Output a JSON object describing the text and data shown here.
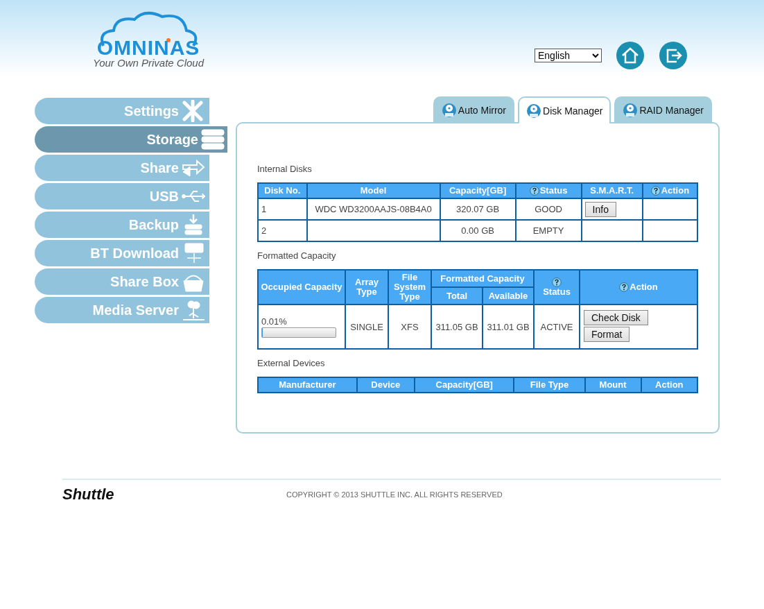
{
  "header": {
    "logo": {
      "brand": "OMNINAS",
      "tagline": "Your Own Private Cloud"
    },
    "language": "English"
  },
  "sidebar": {
    "items": [
      {
        "label": "Settings",
        "selected": false
      },
      {
        "label": "Storage",
        "selected": true
      },
      {
        "label": "Share",
        "selected": false
      },
      {
        "label": "USB",
        "selected": false
      },
      {
        "label": "Backup",
        "selected": false
      },
      {
        "label": "BT Download",
        "selected": false
      },
      {
        "label": "Share Box",
        "selected": false
      },
      {
        "label": "Media Server",
        "selected": false
      }
    ]
  },
  "tabs": [
    {
      "label": "Auto Mirror",
      "selected": false
    },
    {
      "label": "Disk Manager",
      "selected": true
    },
    {
      "label": "RAID Manager",
      "selected": false
    }
  ],
  "internal_disks": {
    "title": "Internal Disks",
    "columns": [
      {
        "label": "Disk No.",
        "help": false
      },
      {
        "label": "Model",
        "help": false
      },
      {
        "label": "Capacity[GB]",
        "help": false
      },
      {
        "label": "Status",
        "help": true
      },
      {
        "label": "S.M.A.R.T.",
        "help": false
      },
      {
        "label": "Action",
        "help": true
      }
    ],
    "rows": [
      {
        "disk_no": "1",
        "model": "WDC WD3200AAJS-08B4A0",
        "capacity": "320.07 GB",
        "status": "GOOD",
        "smart_button": "Info"
      },
      {
        "disk_no": "2",
        "capacity": "0.00 GB",
        "status": "EMPTY"
      }
    ]
  },
  "formatted_capacity": {
    "title": "Formatted Capacity",
    "headers": {
      "occupied": {
        "label": "Occupied Capacity",
        "help": false
      },
      "array_type": {
        "label": "Array Type",
        "help": false
      },
      "file_system": {
        "label": "File System Type",
        "help": false
      },
      "formatted": {
        "label": "Formatted Capacity",
        "help": false
      },
      "total": {
        "label": "Total",
        "help": false
      },
      "available": {
        "label": "Available",
        "help": false
      },
      "status": {
        "label": "Status",
        "help": true
      },
      "action": {
        "label": "Action",
        "help": true
      }
    },
    "rows": [
      {
        "occupied": "0.01%",
        "level": 0.0001,
        "array_type": "SINGLE",
        "file_system": "XFS",
        "total": "311.05 GB",
        "available": "311.01 GB",
        "status": "ACTIVE",
        "actions": [
          "Check Disk",
          "Format"
        ]
      }
    ]
  },
  "external_devices": {
    "title": "External Devices",
    "columns": [
      "Manufacturer",
      "Device",
      "Capacity[GB]",
      "File Type",
      "Mount",
      "Action"
    ]
  },
  "footer": {
    "brand": "Shuttle",
    "copyright": "COPYRIGHT © 2013 SHUTTLE INC. ALL RIGHTS RESERVED"
  }
}
